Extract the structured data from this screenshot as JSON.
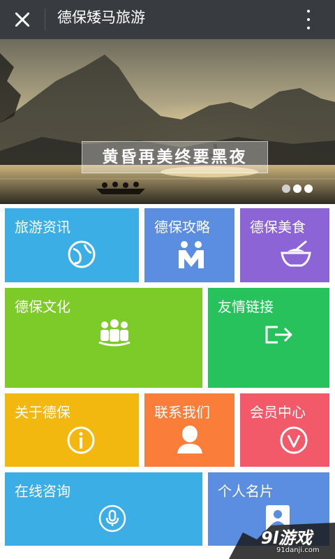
{
  "header": {
    "title": "德保矮马旅游"
  },
  "banner": {
    "caption": "黄昏再美终要黑夜",
    "slide_count": 3,
    "active_slide": 1
  },
  "tiles": [
    {
      "label": "旅游资讯",
      "icon": "globe-icon",
      "color": "#3baee6"
    },
    {
      "label": "德保攻略",
      "icon": "people-m-icon",
      "color": "#5b8ee0"
    },
    {
      "label": "德保美食",
      "icon": "bowl-icon",
      "color": "#8d64d6"
    },
    {
      "label": "德保文化",
      "icon": "group-icon",
      "color": "#7ccb28"
    },
    {
      "label": "友情链接",
      "icon": "link-arrow-icon",
      "color": "#27c25c"
    },
    {
      "label": "关于德保",
      "icon": "info-icon",
      "color": "#f2b80f"
    },
    {
      "label": "联系我们",
      "icon": "contact-icon",
      "color": "#fb7d3a"
    },
    {
      "label": "会员中心",
      "icon": "vip-icon",
      "color": "#f25a6a"
    },
    {
      "label": "在线咨询",
      "icon": "mic-icon",
      "color": "#3baee6"
    },
    {
      "label": "个人名片",
      "icon": "card-icon",
      "color": "#5b8ee0"
    }
  ],
  "watermark": {
    "logo": "9l游戏",
    "url": "91danji.com"
  }
}
